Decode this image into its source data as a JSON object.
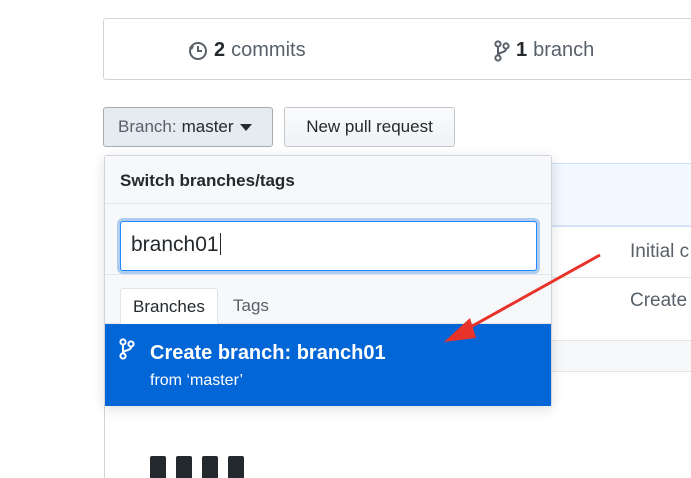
{
  "summary": {
    "commits_count": "2",
    "commits_label": "commits",
    "branches_count": "1",
    "branches_label": "branch"
  },
  "toolbar": {
    "branch_prefix": "Branch:",
    "branch_name": "master",
    "new_pr_label": "New pull request"
  },
  "dropdown": {
    "header": "Switch branches/tags",
    "filter_value": "branch01",
    "tabs": [
      {
        "label": "Branches",
        "active": true
      },
      {
        "label": "Tags",
        "active": false
      }
    ],
    "create": {
      "title": "Create branch: branch01",
      "subtitle": "from ‘master’"
    }
  },
  "background": {
    "row1_text": "Initial c",
    "row2_text": "Create"
  },
  "colors": {
    "accent": "#0366d6",
    "annotation_arrow": "#e8332b"
  },
  "icons": {
    "commits": "history-icon",
    "branch": "git-branch-icon",
    "caret": "caret-down-icon",
    "create_branch": "git-branch-icon"
  }
}
